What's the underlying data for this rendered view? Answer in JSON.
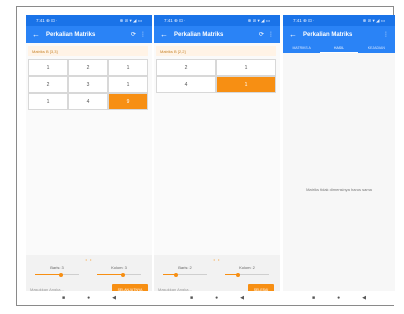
{
  "screens": [
    {
      "status": {
        "time": "7:41 ⊕ ⊡ ·",
        "icons": "⊕ ⊘ ▾ ◢ ▭"
      },
      "appbar": {
        "title": "Perkalian Matriks"
      },
      "matrix_label": "Matriks B [3,3]",
      "cells": [
        "1",
        "2",
        "1",
        "2",
        "3",
        "1",
        "1",
        "4",
        "9"
      ],
      "pager": "• •",
      "slider_rows": {
        "label": "Baris: 3",
        "value": 0.6
      },
      "slider_cols": {
        "label": "Kolom: 3",
        "value": 0.6
      },
      "input": {
        "placeholder": "Masukkan Angka..."
      },
      "button": {
        "label": "SELANJUTNYA"
      }
    },
    {
      "status": {
        "time": "7:41 ⊕ ⊡ ·",
        "icons": "⊕ ⊘ ▾ ◢ ▭"
      },
      "appbar": {
        "title": "Perkalian Matriks"
      },
      "matrix_label": "Matriks B [2,2]",
      "cells": [
        "2",
        "1",
        "4",
        "1"
      ],
      "pager": "• •",
      "slider_rows": {
        "label": "Baris: 2",
        "value": 0.3
      },
      "slider_cols": {
        "label": "Kolom: 2",
        "value": 0.3
      },
      "input": {
        "placeholder": "Masukkan Angka..."
      },
      "button": {
        "label": "SELESAI"
      }
    },
    {
      "status": {
        "time": "7:41 ⊕ ⊡ ·",
        "icons": "⊕ ⊘ ▾ ◢ ▭"
      },
      "appbar": {
        "title": "Perkalian Matriks"
      },
      "tabs": [
        "MATRIKS A",
        "HASIL",
        "KEJADIAN"
      ],
      "message": "Matriks tidak dimensinya harus sama"
    }
  ],
  "nav": {
    "back": "◀",
    "home": "●",
    "recent": "■"
  },
  "colors": {
    "primary": "#2a83f6",
    "status": "#1a73e8",
    "accent": "#f78f13"
  }
}
